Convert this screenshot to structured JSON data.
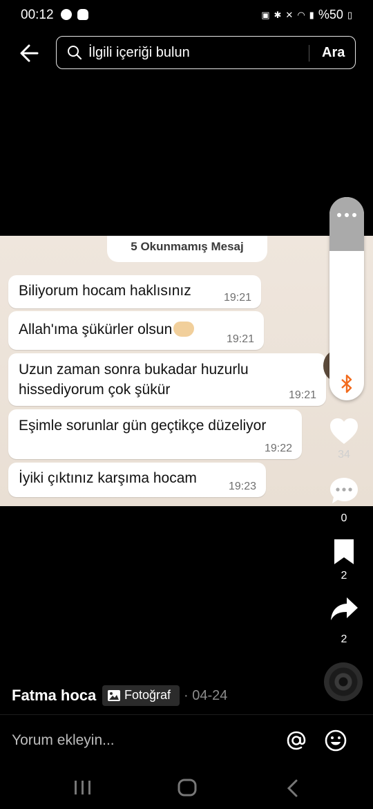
{
  "status_bar": {
    "time": "00:12",
    "battery": "%50"
  },
  "search": {
    "placeholder": "İlgili içeriği bulun",
    "button_label": "Ara"
  },
  "photo": {
    "unread_label": "5 Okunmamış Mesaj",
    "messages": [
      {
        "line1": "Biliyorum hocam haklısınız",
        "line2": "",
        "time": "19:21"
      },
      {
        "line1": "Allah'ıma şükürler olsun",
        "line2": "",
        "time": "19:21"
      },
      {
        "line1": "Uzun zaman sonra bukadar huzurlu",
        "line2": "hissediyorum çok şükür",
        "time": "19:21"
      },
      {
        "line1": "Eşimle sorunlar gün geçtikçe düzeliyor",
        "line2": "",
        "time": "19:22"
      },
      {
        "line1": "İyiki çıktınız karşıma hocam",
        "line2": "",
        "time": "19:23"
      }
    ]
  },
  "actions": {
    "like_count": "34",
    "comment_count": "0",
    "bookmark_count": "2",
    "share_count": "2"
  },
  "post": {
    "author": "Fatma hoca",
    "type_label": "Fotoğraf",
    "date": "· 04-24"
  },
  "comment_bar": {
    "placeholder": "Yorum ekleyin..."
  },
  "icons": {
    "back": "arrow-left-icon",
    "search": "search-icon",
    "like": "heart-icon",
    "comment": "chat-bubble-icon",
    "bookmark": "bookmark-icon",
    "share": "share-arrow-icon",
    "mention": "at-sign-icon",
    "emoji": "smiley-icon"
  },
  "colors": {
    "background": "#000000",
    "chat_background": "#ece3d9",
    "bubble": "#ffffff",
    "bluetooth_accent": "#f26b1d"
  }
}
